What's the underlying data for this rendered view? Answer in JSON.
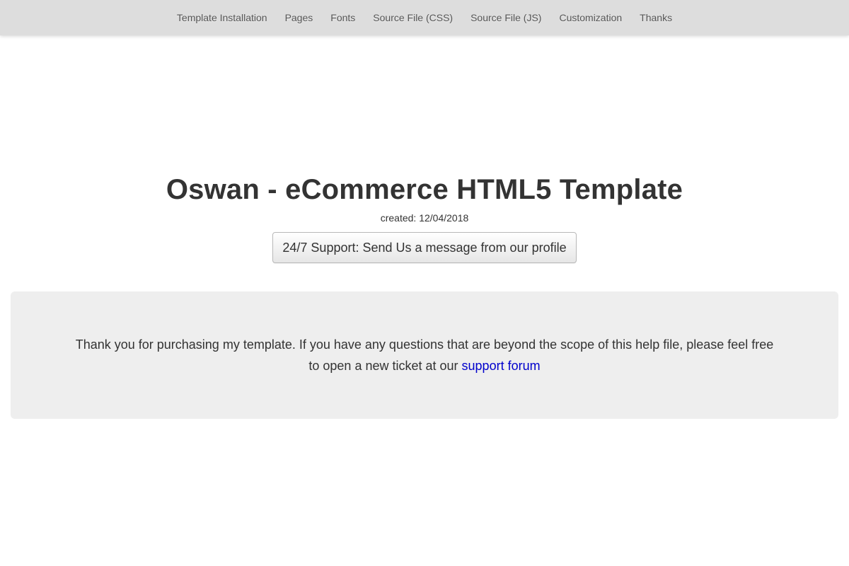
{
  "nav": {
    "items": [
      {
        "label": "Template Installation"
      },
      {
        "label": "Pages"
      },
      {
        "label": "Fonts"
      },
      {
        "label": "Source File (CSS)"
      },
      {
        "label": "Source File (JS)"
      },
      {
        "label": "Customization"
      },
      {
        "label": "Thanks"
      }
    ]
  },
  "hero": {
    "title": "Oswan - eCommerce HTML5 Template",
    "created": "created: 12/04/2018",
    "support_button": "24/7 Support: Send Us a message from our profile"
  },
  "thanks_panel": {
    "text_before_link": "Thank you for purchasing my template. If you have any questions that are beyond the scope of this help file, please feel free to open a new ticket at our ",
    "link_text": "support forum"
  },
  "colors": {
    "nav_background": "#dddddd",
    "panel_background": "#eeeeee",
    "link": "#0000cc",
    "text": "#333333"
  }
}
